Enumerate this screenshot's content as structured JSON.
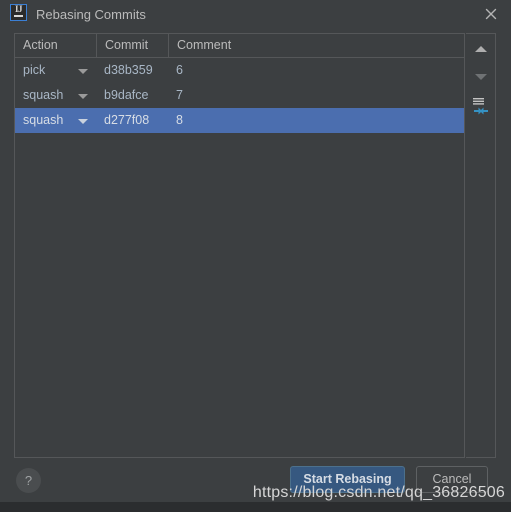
{
  "window": {
    "title": "Rebasing Commits",
    "app_icon": "intellij-idea-icon",
    "app_icon_text": "IJ",
    "close_icon": "close-icon"
  },
  "table": {
    "columns": [
      {
        "key": "action",
        "label": "Action"
      },
      {
        "key": "commit",
        "label": "Commit"
      },
      {
        "key": "comment",
        "label": "Comment"
      }
    ],
    "rows": [
      {
        "action": "pick",
        "commit": "d38b359",
        "comment": "6",
        "selected": false
      },
      {
        "action": "squash",
        "commit": "b9dafce",
        "comment": "7",
        "selected": false
      },
      {
        "action": "squash",
        "commit": "d277f08",
        "comment": "8",
        "selected": true
      }
    ]
  },
  "side_toolbar": {
    "items": [
      {
        "name": "move-up-button",
        "icon": "arrow-up-icon",
        "enabled": true
      },
      {
        "name": "move-down-button",
        "icon": "arrow-down-icon",
        "enabled": false
      },
      {
        "name": "squash-commits-button",
        "icon": "squash-icon",
        "enabled": true
      }
    ]
  },
  "footer": {
    "help_label": "?",
    "start_rebasing_label": "Start Rebasing",
    "cancel_label": "Cancel"
  },
  "watermark": {
    "text": "https://blog.csdn.net/qq_36826506"
  },
  "colors": {
    "dialog_background": "#3c3f41",
    "desktop_background": "#2f3133",
    "text_primary": "#bbbbbb",
    "text_table": "#a9b7c6",
    "selection_blue": "#4b6eaf",
    "accent_button_blue": "#365880",
    "border": "#555759",
    "squash_icon_blue": "#3592c4"
  }
}
